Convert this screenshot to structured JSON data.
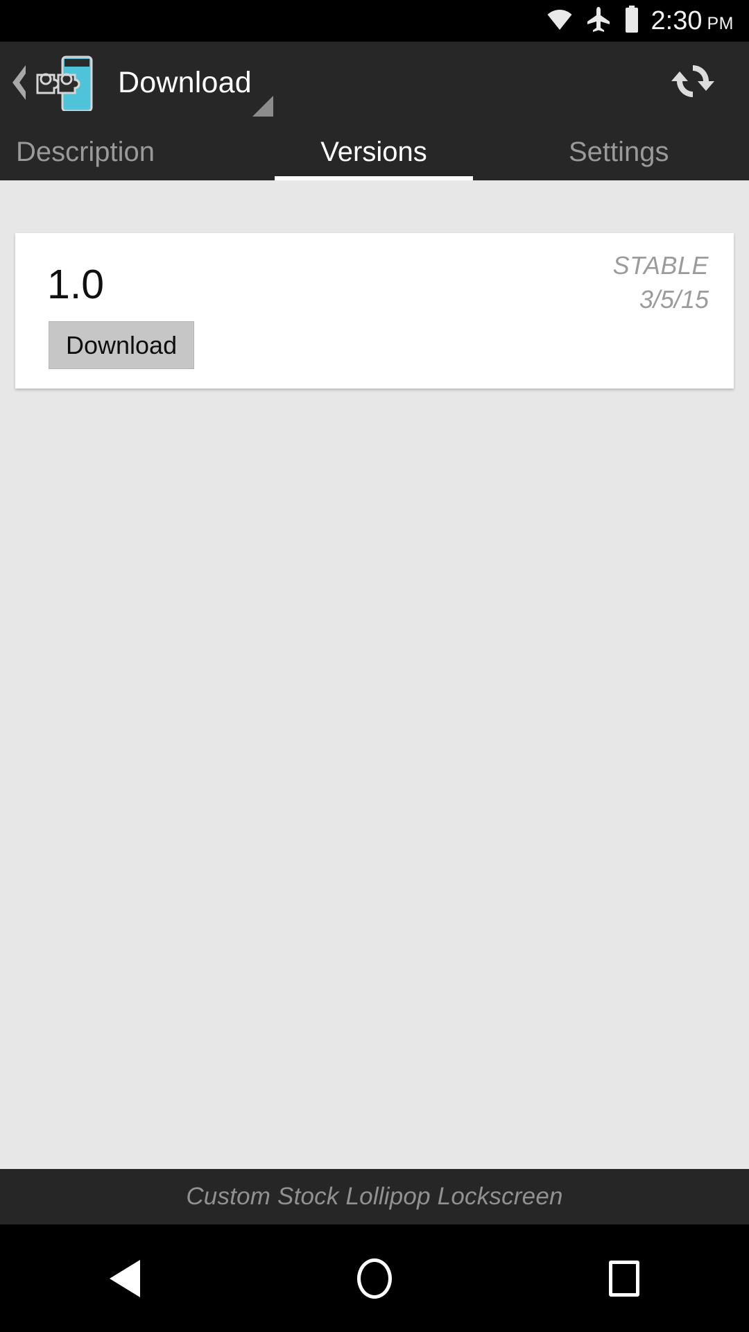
{
  "status_bar": {
    "time": "2:30",
    "ampm": "PM",
    "icons": [
      "wifi-icon",
      "airplane-mode-icon",
      "battery-icon"
    ]
  },
  "app_bar": {
    "back_label": "back-chevron",
    "app_icon": "xposed-puzzle-icon",
    "title": "Download",
    "spinner_indicator": "dropdown-triangle-icon",
    "refresh_icon": "refresh-icon",
    "accent_color": "#4ec3d9",
    "background_color": "#272727"
  },
  "tabs": {
    "items": [
      {
        "label": "Description",
        "active": false
      },
      {
        "label": "Versions",
        "active": true
      },
      {
        "label": "Settings",
        "active": false
      }
    ],
    "active_index": 1,
    "active_label": "Versions",
    "inactive_color": "#9a9a9a",
    "active_color": "#ffffff"
  },
  "content": {
    "background_color": "#e7e7e7",
    "versions": [
      {
        "version": "1.0",
        "branch": "STABLE",
        "date": "3/5/15",
        "action_label": "Download"
      }
    ]
  },
  "bottom_bar": {
    "text": "Custom Stock Lollipop Lockscreen",
    "text_color": "#919191"
  },
  "nav_bar": {
    "back": "nav-back-triangle-icon",
    "home": "nav-home-circle-icon",
    "recents": "nav-recents-square-icon"
  }
}
